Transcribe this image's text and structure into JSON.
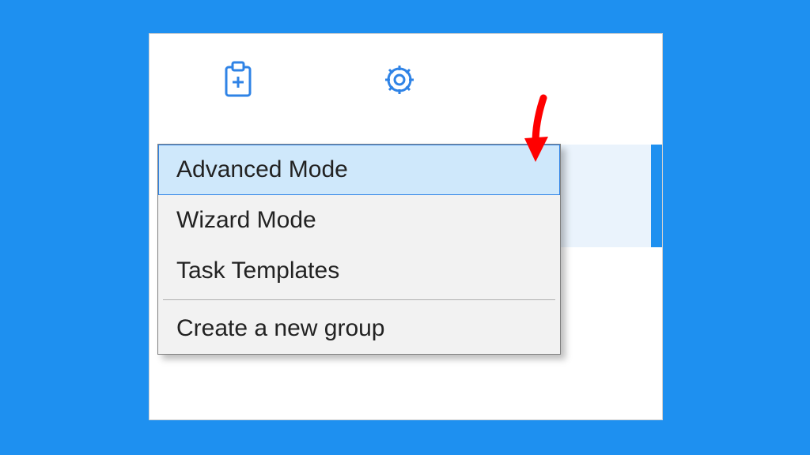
{
  "menu": {
    "items": [
      {
        "label": "Advanced Mode",
        "highlighted": true
      },
      {
        "label": "Wizard Mode",
        "highlighted": false
      },
      {
        "label": "Task Templates",
        "highlighted": false
      }
    ],
    "footer": {
      "label": "Create a new group"
    }
  },
  "toolbar": {
    "icons": {
      "add_task": "clipboard-plus-icon",
      "settings": "gear-icon"
    }
  },
  "annotation": {
    "arrow_color": "#ff0000"
  },
  "colors": {
    "accent": "#1e90f0",
    "highlight_bg": "#cfe8fb",
    "highlight_border": "#2f83e6"
  }
}
